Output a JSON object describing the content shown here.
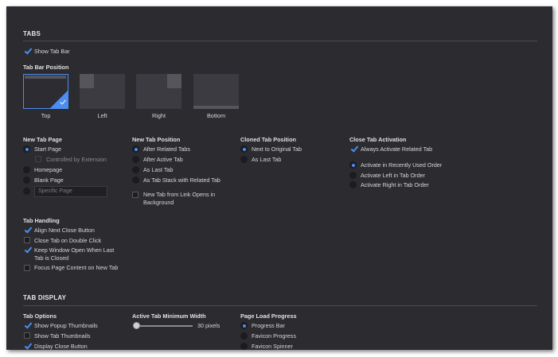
{
  "tabs": {
    "heading": "TABS",
    "show_tab_bar": {
      "label": "Show Tab Bar",
      "checked": true
    },
    "tab_bar_position": {
      "title": "Tab Bar Position",
      "options": [
        {
          "label": "Top",
          "selected": true
        },
        {
          "label": "Left",
          "selected": false
        },
        {
          "label": "Right",
          "selected": false
        },
        {
          "label": "Bottom",
          "selected": false
        }
      ]
    },
    "new_tab_page": {
      "title": "New Tab Page",
      "start_page": "Start Page",
      "controlled_by_extension": "Controlled by Extension",
      "homepage": "Homepage",
      "blank_page": "Blank Page",
      "specific_page_placeholder": "Specific Page",
      "selected": "Start Page"
    },
    "new_tab_position": {
      "title": "New Tab Position",
      "options": [
        "After Related Tabs",
        "After Active Tab",
        "As Last Tab",
        "As Tab Stack with Related Tab"
      ],
      "selected": "After Related Tabs",
      "link_background_line1": "New Tab from Link Opens in",
      "link_background_line2": "Background",
      "link_background_checked": false
    },
    "cloned_tab_position": {
      "title": "Cloned Tab Position",
      "options": [
        "Next to Original Tab",
        "As Last Tab"
      ],
      "selected": "Next to Original Tab"
    },
    "close_tab_activation": {
      "title": "Close Tab Activation",
      "always_activate_related": "Always Activate Related Tab",
      "always_activate_related_checked": true,
      "options": [
        "Activate in Recently Used Order",
        "Activate Left in Tab Order",
        "Activate Right in Tab Order"
      ],
      "selected": "Activate in Recently Used Order"
    },
    "tab_handling": {
      "title": "Tab Handling",
      "align_next_close": "Align Next Close Button",
      "align_next_close_checked": true,
      "close_on_double_click": "Close Tab on Double Click",
      "close_on_double_click_checked": false,
      "keep_window_open_line1": "Keep Window Open When Last",
      "keep_window_open_line2": "Tab is Closed",
      "keep_window_open_checked": true,
      "focus_page_content": "Focus Page Content on New Tab",
      "focus_page_content_checked": false
    }
  },
  "tab_display": {
    "heading": "TAB DISPLAY",
    "tab_options": {
      "title": "Tab Options",
      "show_popup_thumbnails": "Show Popup Thumbnails",
      "show_popup_thumbnails_checked": true,
      "show_tab_thumbnails": "Show Tab Thumbnails",
      "show_tab_thumbnails_checked": false,
      "display_close_button": "Display Close Button",
      "display_close_button_checked": true
    },
    "active_tab_min_width": {
      "title": "Active Tab Minimum Width",
      "value_label": "30 pixels",
      "slider_fraction": 0.0
    },
    "page_load_progress": {
      "title": "Page Load Progress",
      "options": [
        "Progress Bar",
        "Favicon Progress",
        "Favicon Spinner"
      ],
      "selected": "Progress Bar"
    }
  },
  "colors": {
    "accent": "#4d8cf0",
    "background": "#2b2b30"
  }
}
